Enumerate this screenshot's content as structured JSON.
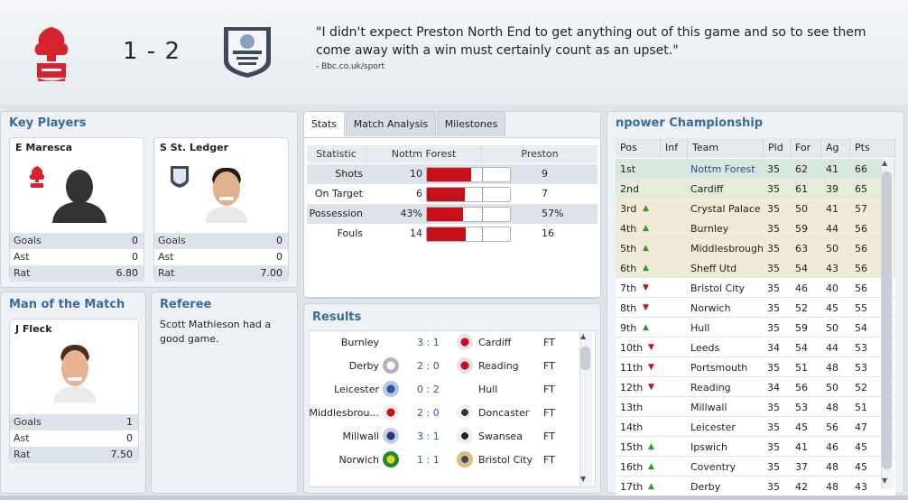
{
  "match": {
    "score": "1 - 2",
    "quote": "\"I didn't expect Preston North End to get anything out of this game and so to see them come away with a win must certainly count as an upset.\"",
    "source": "- Bbc.co.uk/sport",
    "home_crest_text": "FOREST",
    "away_crest_text": "PRESTON NORTH END F.C."
  },
  "key_players": {
    "title": "Key Players",
    "players": [
      {
        "name": "E Maresca",
        "stats": [
          {
            "label": "Goals",
            "value": "0"
          },
          {
            "label": "Ast",
            "value": "0"
          },
          {
            "label": "Rat",
            "value": "6.80"
          }
        ]
      },
      {
        "name": "S St. Ledger",
        "stats": [
          {
            "label": "Goals",
            "value": "0"
          },
          {
            "label": "Ast",
            "value": "0"
          },
          {
            "label": "Rat",
            "value": "7.00"
          }
        ]
      }
    ]
  },
  "motm": {
    "title": "Man of the Match",
    "name": "J Fleck",
    "stats": [
      {
        "label": "Goals",
        "value": "1"
      },
      {
        "label": "Ast",
        "value": "0"
      },
      {
        "label": "Rat",
        "value": "7.50"
      }
    ]
  },
  "referee": {
    "title": "Referee",
    "text": "Scott Mathieson had a good game."
  },
  "tabs": [
    "Stats",
    "Match Analysis",
    "Milestones"
  ],
  "stats": {
    "headers": [
      "Statistic",
      "Nottm Forest",
      "Preston"
    ],
    "rows": [
      {
        "label": "Shots",
        "home": "10",
        "away": "9",
        "home_share": 0.53
      },
      {
        "label": "On Target",
        "home": "6",
        "away": "7",
        "home_share": 0.46
      },
      {
        "label": "Possession",
        "home": "43%",
        "away": "57%",
        "home_share": 0.43
      },
      {
        "label": "Fouls",
        "home": "14",
        "away": "16",
        "home_share": 0.47
      }
    ]
  },
  "results": {
    "title": "Results",
    "rows": [
      {
        "home": "Burnley",
        "score": "3 : 1",
        "away": "Cardiff",
        "status": "FT"
      },
      {
        "home": "Derby",
        "score": "2 : 0",
        "away": "Reading",
        "status": "FT"
      },
      {
        "home": "Leicester",
        "score": "0 : 2",
        "away": "Hull",
        "status": "FT"
      },
      {
        "home": "Middlesbrou...",
        "score": "2 : 0",
        "away": "Doncaster",
        "status": "FT"
      },
      {
        "home": "Millwall",
        "score": "3 : 1",
        "away": "Swansea",
        "status": "FT"
      },
      {
        "home": "Norwich",
        "score": "1 : 1",
        "away": "Bristol City",
        "status": "FT"
      }
    ],
    "colors": {
      "score": "#2b5fa2"
    }
  },
  "table": {
    "title": "npower Championship",
    "headers": [
      "Pos",
      "Inf",
      "Team",
      "Pld",
      "For",
      "Ag",
      "Pts"
    ],
    "rows": [
      {
        "pos": "1st",
        "move": "",
        "team": "Nottm Forest",
        "pld": "35",
        "for": "62",
        "ag": "41",
        "pts": "66"
      },
      {
        "pos": "2nd",
        "move": "",
        "team": "Cardiff",
        "pld": "35",
        "for": "61",
        "ag": "39",
        "pts": "65"
      },
      {
        "pos": "3rd",
        "move": "up",
        "team": "Crystal Palace",
        "pld": "35",
        "for": "50",
        "ag": "41",
        "pts": "57"
      },
      {
        "pos": "4th",
        "move": "up",
        "team": "Burnley",
        "pld": "35",
        "for": "59",
        "ag": "44",
        "pts": "56"
      },
      {
        "pos": "5th",
        "move": "up",
        "team": "Middlesbrough",
        "pld": "35",
        "for": "63",
        "ag": "50",
        "pts": "56"
      },
      {
        "pos": "6th",
        "move": "up",
        "team": "Sheff Utd",
        "pld": "35",
        "for": "54",
        "ag": "43",
        "pts": "56"
      },
      {
        "pos": "7th",
        "move": "down",
        "team": "Bristol City",
        "pld": "35",
        "for": "46",
        "ag": "40",
        "pts": "56"
      },
      {
        "pos": "8th",
        "move": "down",
        "team": "Norwich",
        "pld": "35",
        "for": "52",
        "ag": "45",
        "pts": "55"
      },
      {
        "pos": "9th",
        "move": "up",
        "team": "Hull",
        "pld": "35",
        "for": "59",
        "ag": "50",
        "pts": "54"
      },
      {
        "pos": "10th",
        "move": "down",
        "team": "Leeds",
        "pld": "34",
        "for": "54",
        "ag": "44",
        "pts": "53"
      },
      {
        "pos": "11th",
        "move": "down",
        "team": "Portsmouth",
        "pld": "35",
        "for": "51",
        "ag": "48",
        "pts": "53"
      },
      {
        "pos": "12th",
        "move": "down",
        "team": "Reading",
        "pld": "34",
        "for": "56",
        "ag": "50",
        "pts": "52"
      },
      {
        "pos": "13th",
        "move": "",
        "team": "Millwall",
        "pld": "35",
        "for": "53",
        "ag": "48",
        "pts": "51"
      },
      {
        "pos": "14th",
        "move": "",
        "team": "Leicester",
        "pld": "35",
        "for": "45",
        "ag": "56",
        "pts": "47"
      },
      {
        "pos": "15th",
        "move": "up",
        "team": "Ipswich",
        "pld": "35",
        "for": "41",
        "ag": "46",
        "pts": "45"
      },
      {
        "pos": "16th",
        "move": "up",
        "team": "Coventry",
        "pld": "35",
        "for": "37",
        "ag": "48",
        "pts": "45"
      },
      {
        "pos": "17th",
        "move": "up",
        "team": "Derby",
        "pld": "35",
        "for": "42",
        "ag": "48",
        "pts": "43"
      }
    ],
    "colors": {
      "highlight_team": "#1f4f9a",
      "up": "#2a9a2a",
      "down": "#c8101a"
    }
  },
  "colors": {
    "accent": "#3c6a99",
    "bar_fill": "#c8101a"
  }
}
